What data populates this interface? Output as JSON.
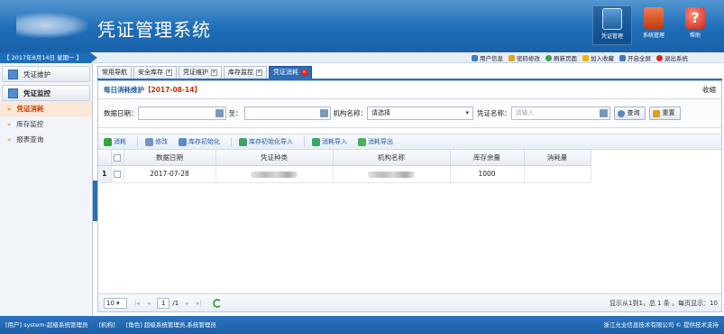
{
  "header": {
    "title": "凭证管理系统",
    "nav": [
      {
        "label": "凭证管理",
        "icon": "certificate-icon",
        "active": true
      },
      {
        "label": "系统管理",
        "icon": "system-icon",
        "active": false
      },
      {
        "label": "帮助",
        "icon": "help-icon",
        "active": false
      }
    ]
  },
  "topbar": {
    "date": "【 2017年8月14日 星期一 】",
    "links": [
      {
        "label": "用户信息",
        "icon": "user-icon",
        "color": "#3a7bc8"
      },
      {
        "label": "密码修改",
        "icon": "key-icon",
        "color": "#e8a020"
      },
      {
        "label": "刷新页面",
        "icon": "refresh-icon",
        "color": "#3aa04a"
      },
      {
        "label": "加入收藏",
        "icon": "star-icon",
        "color": "#f0b400"
      },
      {
        "label": "开启全屏",
        "icon": "fullscreen-icon",
        "color": "#3a7bc8"
      },
      {
        "label": "退出系统",
        "icon": "power-icon",
        "color": "#d9261c"
      }
    ]
  },
  "sidebar": {
    "cat1": "凭证维护",
    "cat2": "凭证监控",
    "items": [
      "凭证消耗",
      "库存监控",
      "报表查询"
    ]
  },
  "tabs": [
    "常用导航",
    "安全库存",
    "凭证维护",
    "库存监控",
    "凭证消耗"
  ],
  "panel": {
    "title": "每日消耗维护",
    "date": "【2017-08-14】",
    "collapse": "收缩"
  },
  "search": {
    "date_label": "数据日期：",
    "to_label": "至：",
    "org_label": "机构名称：",
    "org_value": "请选择",
    "cert_label": "凭证名称：",
    "cert_placeholder": "请输入",
    "query": "查询",
    "reset": "重置"
  },
  "actions": [
    "消耗",
    "修改",
    "库存初始化",
    "库存初始化导入",
    "消耗导入",
    "消耗导出"
  ],
  "table": {
    "headers": [
      "数据日期",
      "凭证种类",
      "机构名称",
      "库存余量",
      "消耗量"
    ],
    "rows": [
      {
        "rownum": "1",
        "date": "2017-07-28",
        "stock": "1000",
        "consume": ""
      }
    ]
  },
  "pager": {
    "page_size": "10",
    "page": "1",
    "total_pages": "/1",
    "info": "显示从1到1，总 1 条 。每页显示：10"
  },
  "footer": {
    "user": "[用户] system-超级系统管理员",
    "org": "[机构]",
    "role": "[角色] 超级系统管理员,系统管理员",
    "copyright": "浙江允业信息技术有限公司 © 提供技术支持"
  }
}
